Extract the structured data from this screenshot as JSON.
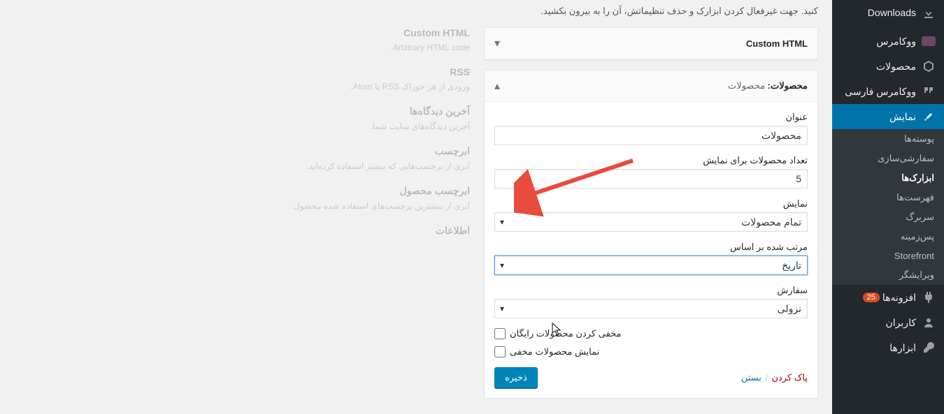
{
  "sidebar": {
    "items": [
      {
        "icon": "download",
        "label": "Downloads"
      },
      {
        "icon": "woo",
        "label": "ووکامرس"
      },
      {
        "icon": "cube",
        "label": "محصولات"
      },
      {
        "icon": "quote",
        "label": "ووکامرس فارسی"
      },
      {
        "icon": "brush",
        "label": "نمایش",
        "active": true,
        "subs": [
          {
            "label": "پوسته‌ها"
          },
          {
            "label": "سفارشی‌سازی"
          },
          {
            "label": "ابزارک‌ها",
            "current": true
          },
          {
            "label": "فهرست‌ها"
          },
          {
            "label": "سربرگ"
          },
          {
            "label": "پس‌زمینه"
          },
          {
            "label": "Storefront"
          },
          {
            "label": "ویرایشگر"
          }
        ]
      },
      {
        "icon": "plugin",
        "label": "افزونه‌ها",
        "badge": "25"
      },
      {
        "icon": "users",
        "label": "کاربران"
      },
      {
        "icon": "tools",
        "label": "ابزارها"
      }
    ]
  },
  "intro": "کنید. جهت غیرفعال کردن ابزارک و حذف تنظیماتش، آن را به بیرون بکشید.",
  "available": [
    {
      "title": "Custom HTML",
      "desc": "Arbitrary HTML code."
    },
    {
      "title": "RSS",
      "desc": "ورودی از هر خوراک RSS یا Atom."
    },
    {
      "title": "آخرین دیدگاه‌ها",
      "desc": "آخرین دیدگاه‌های سایت شما."
    },
    {
      "title": "ابرچسب",
      "desc": "ابری از برچسب‌هایی که بیشتر استفاده کرده‌اید."
    },
    {
      "title": "ابرچسب محصول",
      "desc": "ابری از بیشترین برچسب‌های استفاده شده محصول."
    },
    {
      "title": "اطلاعات",
      "desc": ""
    }
  ],
  "widget_closed": {
    "title": "Custom HTML"
  },
  "widget_open": {
    "title": "محصولات:",
    "subtitle": "محصولات",
    "fields": {
      "title_label": "عنوان",
      "title_value": "محصولات",
      "count_label": "تعداد محصولات برای نمایش",
      "count_value": "5",
      "show_label": "نمایش",
      "show_value": "تمام محصولات",
      "orderby_label": "مرتب شده بر اساس",
      "orderby_value": "تاریخ",
      "order_label": "سفارش",
      "order_value": "نزولی",
      "hide_free": "مخفی کردن محصولات رایگان",
      "show_hidden": "نمایش محصولات مخفی"
    },
    "actions": {
      "delete": "پاک کردن",
      "close": "بستن",
      "save": "ذخیره"
    }
  }
}
